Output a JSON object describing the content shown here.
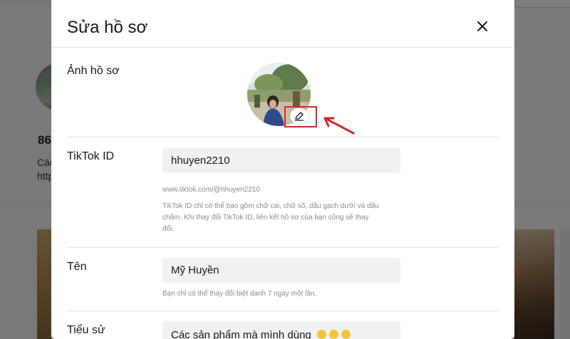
{
  "background": {
    "count_text": "86",
    "line1_text": "Các",
    "line2_text": "http"
  },
  "modal": {
    "title": "Sửa hồ sơ",
    "close_icon": "close-icon"
  },
  "profile_photo": {
    "label": "Ảnh hồ sơ",
    "edit_icon": "pencil-icon",
    "annotation_color": "#d7262c"
  },
  "tiktok_id": {
    "label": "TikTok ID",
    "value": "hhuyen2210",
    "url": "www.tiktok.com/@hhuyen2210",
    "hint_line1": "TikTok ID chỉ có thể bao gồm chữ cái, chữ số, dấu gạch dưới và dấu",
    "hint_line2": "chấm. Khi thay đổi TikTok ID, liên kết hồ sơ của bạn cũng sẽ thay",
    "hint_line3": "đổi."
  },
  "name": {
    "label": "Tên",
    "value": "Mỹ Huyền",
    "hint": "Bạn chỉ có thể thay đổi biệt danh 7 ngày một lần."
  },
  "bio": {
    "label": "Tiểu sử",
    "value": "Các sản phẩm mà mình dùng"
  }
}
